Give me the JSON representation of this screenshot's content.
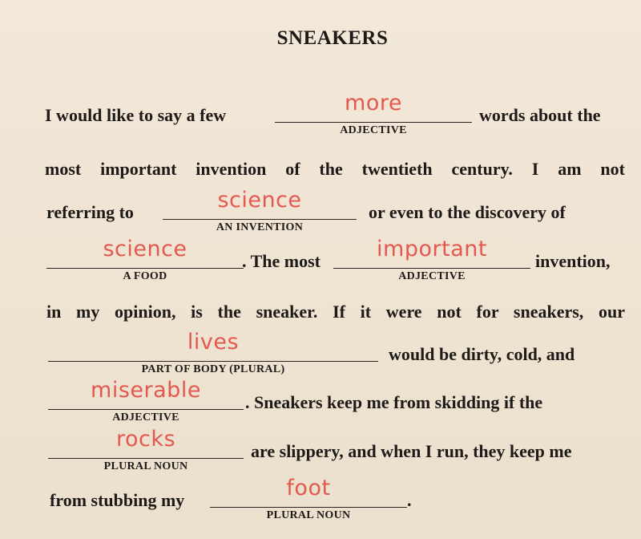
{
  "title": "SNEAKERS",
  "lines": {
    "l1": {
      "pre": "I would like to say a few",
      "blank_caption": "ADJECTIVE",
      "blank_answer": "more",
      "post": "words about the"
    },
    "l2": {
      "text": "most important invention of the twentieth century. I am not"
    },
    "l3": {
      "pre": "referring to",
      "blank_caption": "AN INVENTION",
      "blank_answer": "science",
      "post": "or even to the discovery of"
    },
    "l4": {
      "blank1_caption": "A FOOD",
      "blank1_answer": "science",
      "mid": ". The most",
      "blank2_caption": "ADJECTIVE",
      "blank2_answer": "important",
      "post": "invention,"
    },
    "l5": {
      "text": "in my opinion, is the sneaker. If it were not for sneakers, our"
    },
    "l6": {
      "blank_caption": "PART OF BODY (PLURAL)",
      "blank_answer": "lives",
      "post": "would be dirty, cold, and"
    },
    "l7": {
      "blank_caption": "ADJECTIVE",
      "blank_answer": "miserable",
      "post": ". Sneakers keep me from skidding if the"
    },
    "l8": {
      "blank_caption": "PLURAL NOUN",
      "blank_answer": "rocks",
      "post": "are slippery, and when I run, they keep me"
    },
    "l9": {
      "pre": "from stubbing my",
      "blank_caption": "PLURAL NOUN",
      "blank_answer": "foot",
      "post": "."
    }
  },
  "colors": {
    "paper": "#f1e6d6",
    "ink": "#1d1a17",
    "handwriting": "#e4594f"
  }
}
